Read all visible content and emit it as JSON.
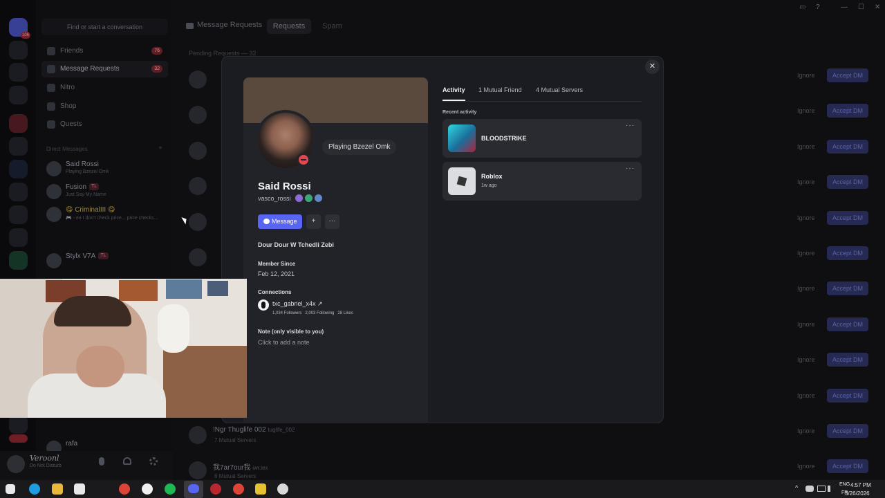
{
  "sidebar": {
    "search_placeholder": "Find or start a conversation",
    "nav": [
      {
        "label": "Friends",
        "count": "76"
      },
      {
        "label": "Message Requests",
        "count": "32"
      },
      {
        "label": "Nitro",
        "count": ""
      },
      {
        "label": "Shop",
        "count": ""
      },
      {
        "label": "Quests",
        "count": ""
      }
    ],
    "direct_messages_header": "Direct Messages",
    "dms": [
      {
        "name": "Said Rossi",
        "status": "Playing Bzezel Omk",
        "tag": ""
      },
      {
        "name": "Fusion",
        "status": "Just Say My Name",
        "tag": "TL"
      },
      {
        "name": "😋 CriminalIII 😋",
        "status": "🎮 - ea I don't check price... price checks...",
        "tag": ""
      },
      {
        "name": "Stylx V7A",
        "status": "",
        "tag": "TL"
      },
      {
        "name": "rafa",
        "status": "",
        "tag": ""
      }
    ],
    "server_badge": "106",
    "user": {
      "name": "Veroonl",
      "status": "Do Not Disturb"
    }
  },
  "main": {
    "header": "Message Requests",
    "tabs": [
      "Requests",
      "Spam"
    ],
    "pending": "Pending Requests — 32",
    "ignore_label": "Ignore",
    "accept_label": "Accept DM",
    "visible_rows": [
      {
        "name": "!Ngr Thuglife 002",
        "handle": "tuglife_002",
        "sub": "7 Mutual Servers"
      },
      {
        "name": "我7ar7our我",
        "handle": "iwr.iex",
        "sub": "6 Mutual Servers"
      }
    ]
  },
  "profile": {
    "display_name": "Said Rossi",
    "username": "vasco_rossi",
    "activity": "Playing Bzezel Omk",
    "message_button": "Message",
    "bio": "Dour Dour W Tchedli Zebi",
    "member_since_label": "Member Since",
    "member_since": "Feb 12, 2021",
    "connections_label": "Connections",
    "connection": {
      "name": "txc_gabriel_x4x ↗",
      "followers": "1,034 Followers",
      "following": "2,003 Following",
      "likes": "28 Likes"
    },
    "note_label": "Note (only visible to you)",
    "note_placeholder": "Click to add a note",
    "tabs": [
      "Activity",
      "1 Mutual Friend",
      "4 Mutual Servers"
    ],
    "recent_activity_label": "Recent activity",
    "activities": [
      {
        "game": "BLOODSTRIKE",
        "time": ""
      },
      {
        "game": "Roblox",
        "time": "1w ago"
      }
    ]
  },
  "taskbar": {
    "language": "ENG",
    "region": "FR",
    "time": "4:57 PM",
    "date": "3/26/2026"
  },
  "colors": {
    "accent": "#5865f2",
    "dnd": "#e0484f",
    "badge": "#c2303a"
  }
}
